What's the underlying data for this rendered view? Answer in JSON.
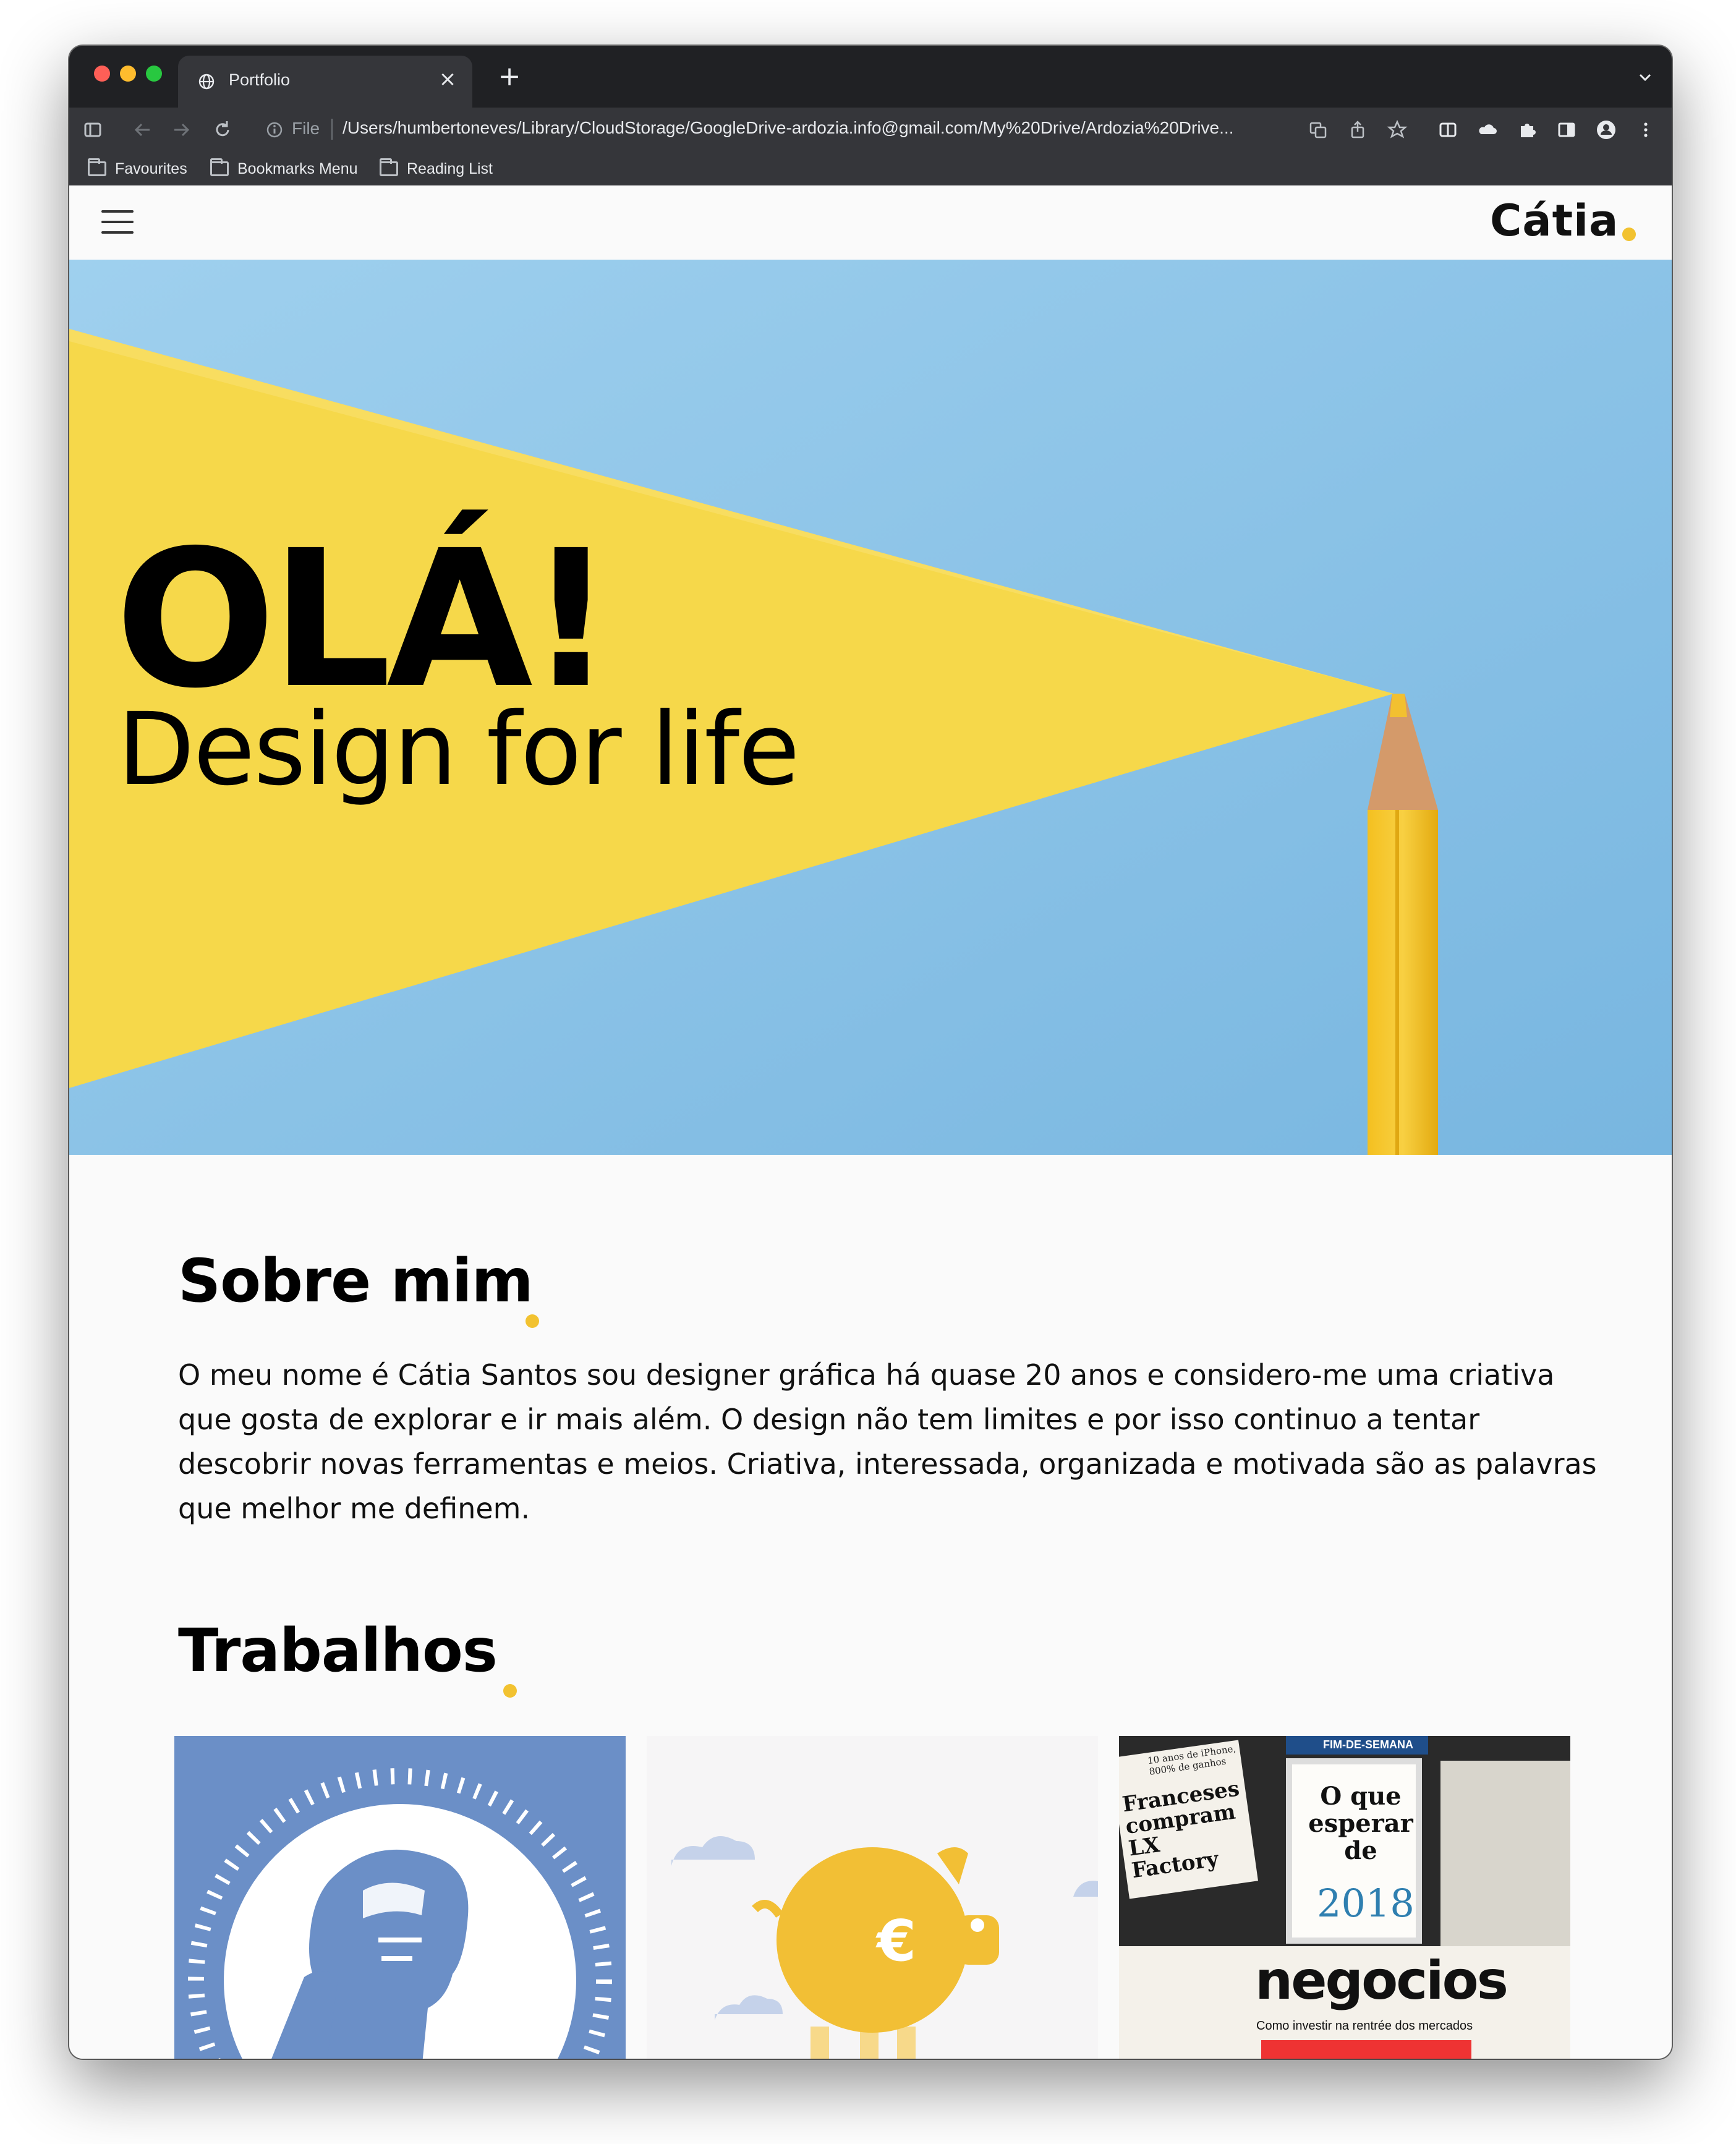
{
  "browser": {
    "tab_title": "Portfolio",
    "close_glyph": "×",
    "new_tab_glyph": "+",
    "scheme_label": "File",
    "url": "/Users/humbertoneves/Library/CloudStorage/GoogleDrive-ardozia.info@gmail.com/My%20Drive/Ardozia%20Drive...",
    "bookmarks": [
      "Favourites",
      "Bookmarks Menu",
      "Reading List"
    ],
    "colors": {
      "frame": "#202124",
      "toolbar": "#35363a",
      "text": "#e8eaed"
    }
  },
  "site": {
    "logo": "Cátia",
    "hero": {
      "title": "OLÁ!",
      "subtitle": "Design for life"
    },
    "about": {
      "title": "Sobre mim",
      "text": "O meu nome é Cátia Santos sou designer gráfica há quase 20 anos e considero-me uma criativa que gosta de explorar e ir mais além. O design não tem limites e por isso continuo a tentar descobrir novas ferramentas e meios. Criativa, interessada, organizada e motivada são as palavras que melhor me definem."
    },
    "works": {
      "title": "Trabalhos",
      "items": [
        {
          "name": "portrait-illustration"
        },
        {
          "name": "piggy-bank-illustration",
          "symbol": "€"
        },
        {
          "name": "newspaper-collage",
          "headline1": "O que esperar de",
          "year": "2018",
          "brand": "negocios",
          "line": "Como investir na rentrée dos mercados",
          "side": "Franceses compram LX Factory",
          "tag": "10 anos de iPhone, 800% de ganhos",
          "band": "FIM-DE-SEMANA"
        }
      ]
    },
    "colors": {
      "accent": "#f2c230",
      "sky": "#8cc3e8",
      "yellow": "#f6d84a",
      "card_blue": "#6b8fc7"
    }
  }
}
